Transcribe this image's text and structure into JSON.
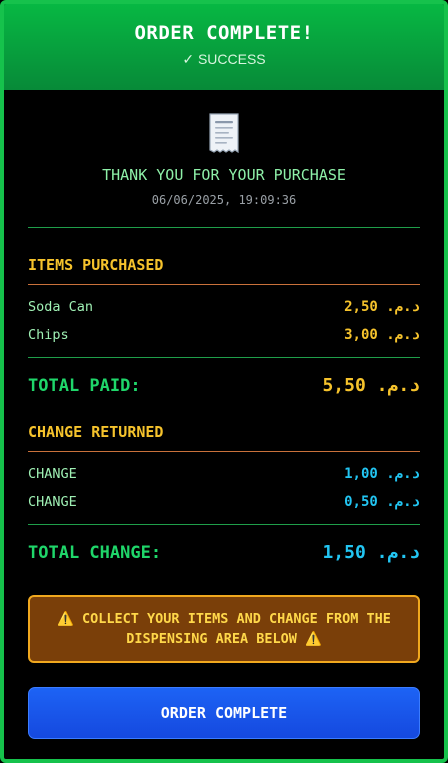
{
  "header": {
    "title": "ORDER COMPLETE!",
    "subtitle": "✓ SUCCESS"
  },
  "receipt": {
    "icon": "receipt-icon",
    "thanks": "THANK YOU FOR YOUR PURCHASE",
    "datetime": "06/06/2025, 19:09:36"
  },
  "items": {
    "title": "ITEMS PURCHASED",
    "rows": [
      {
        "label": "Soda Can",
        "amount": "د.م. 2,50"
      },
      {
        "label": "Chips",
        "amount": "د.م. 3,00"
      }
    ],
    "total_label": "TOTAL PAID:",
    "total_amount": "د.م. 5,50"
  },
  "change": {
    "title": "CHANGE RETURNED",
    "rows": [
      {
        "label": "CHANGE",
        "amount": "د.م. 1,00"
      },
      {
        "label": "CHANGE",
        "amount": "د.م. 0,50"
      }
    ],
    "total_label": "TOTAL CHANGE:",
    "total_amount": "د.م. 1,50"
  },
  "notice": {
    "icon": "warning-icon",
    "text": "⚠️ COLLECT YOUR ITEMS AND CHANGE FROM THE DISPENSING AREA BELOW ⚠️"
  },
  "button": {
    "label": "ORDER COMPLETE"
  },
  "colors": {
    "success": "#16c24c",
    "accent_yellow": "#f6c32c",
    "accent_cyan": "#22c5f2",
    "button": "#1d63f5"
  }
}
